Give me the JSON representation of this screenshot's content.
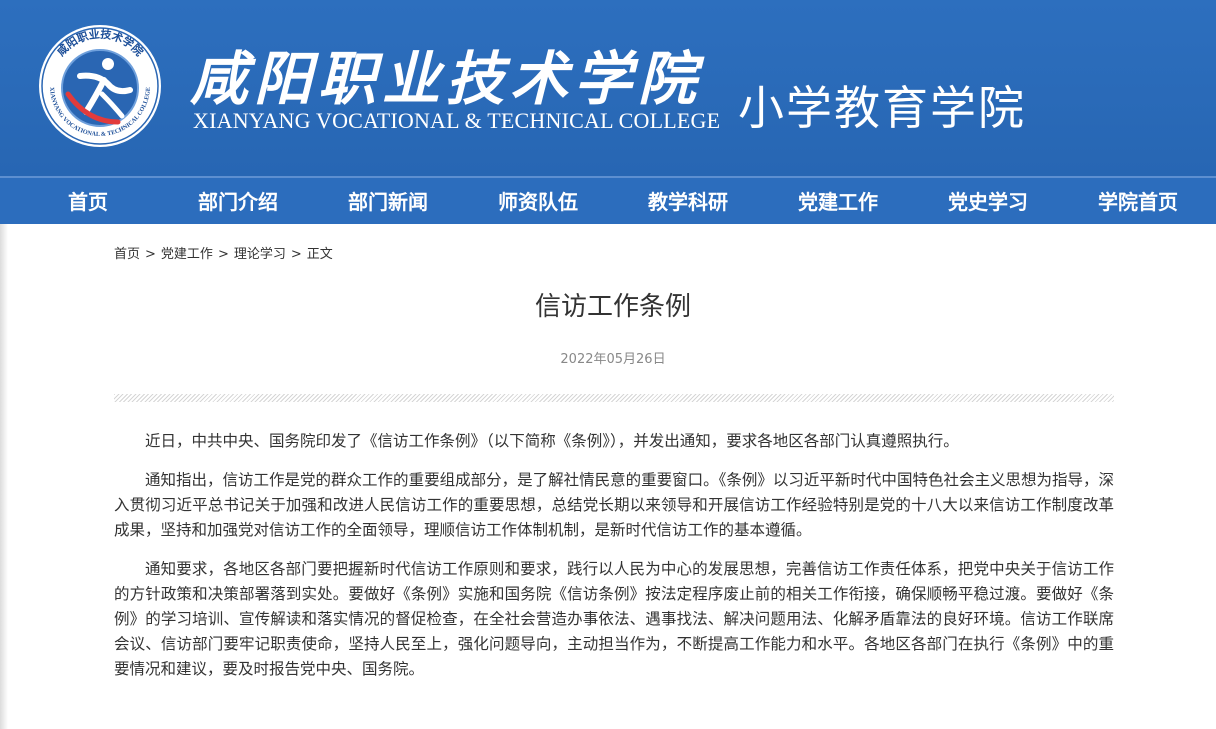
{
  "header": {
    "college_cn": "咸阳职业技术学院",
    "college_en": "XIANYANG VOCATIONAL & TECHNICAL COLLEGE",
    "school_name": "小学教育学院",
    "logo_ring_text": "咸阳职业技术学院",
    "logo_ring_text_en": "XIANYANG VOCATIONAL & TECHNICAL COLLEGE"
  },
  "nav": {
    "items": [
      {
        "label": "首页"
      },
      {
        "label": "部门介绍"
      },
      {
        "label": "部门新闻"
      },
      {
        "label": "师资队伍"
      },
      {
        "label": "教学科研"
      },
      {
        "label": "党建工作"
      },
      {
        "label": "党史学习"
      },
      {
        "label": "学院首页"
      }
    ]
  },
  "breadcrumb": {
    "items": [
      "首页",
      "党建工作",
      "理论学习",
      "正文"
    ],
    "separator": ">"
  },
  "article": {
    "title": "信访工作条例",
    "date": "2022年05月26日",
    "paragraphs": [
      "近日，中共中央、国务院印发了《信访工作条例》（以下简称《条例》），并发出通知，要求各地区各部门认真遵照执行。",
      "通知指出，信访工作是党的群众工作的重要组成部分，是了解社情民意的重要窗口。《条例》以习近平新时代中国特色社会主义思想为指导，深入贯彻习近平总书记关于加强和改进人民信访工作的重要思想，总结党长期以来领导和开展信访工作经验特别是党的十八大以来信访工作制度改革成果，坚持和加强党对信访工作的全面领导，理顺信访工作体制机制，是新时代信访工作的基本遵循。",
      "通知要求，各地区各部门要把握新时代信访工作原则和要求，践行以人民为中心的发展思想，完善信访工作责任体系，把党中央关于信访工作的方针政策和决策部署落到实处。要做好《条例》实施和国务院《信访条例》按法定程序废止前的相关工作衔接，确保顺畅平稳过渡。要做好《条例》的学习培训、宣传解读和落实情况的督促检查，在全社会营造办事依法、遇事找法、解决问题用法、化解矛盾靠法的良好环境。信访工作联席会议、信访部门要牢记职责使命，坚持人民至上，强化问题导向，主动担当作为，不断提高工作能力和水平。各地区各部门在执行《条例》中的重要情况和建议，要及时报告党中央、国务院。"
    ]
  },
  "colors": {
    "header_bg": "#2d6fbe",
    "nav_bg": "#2c6dbd",
    "text": "#333333",
    "date": "#888888"
  }
}
